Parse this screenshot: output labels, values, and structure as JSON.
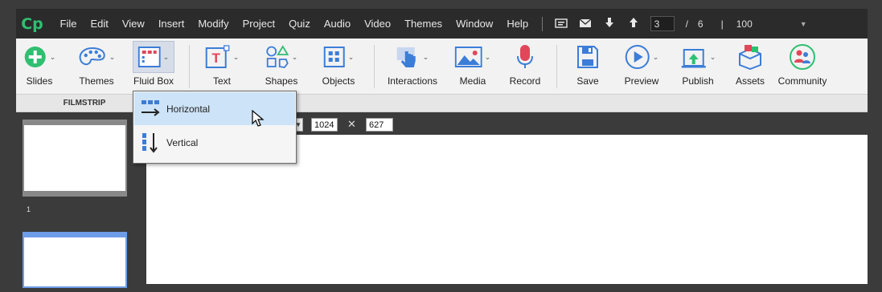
{
  "app": {
    "logo": "Cp"
  },
  "menubar": {
    "items": [
      "File",
      "Edit",
      "View",
      "Insert",
      "Modify",
      "Project",
      "Quiz",
      "Audio",
      "Video",
      "Themes",
      "Window",
      "Help"
    ],
    "icons": [
      "closed-caption-icon",
      "mail-icon",
      "arrow-down-icon",
      "arrow-up-icon"
    ],
    "slide_current": "3",
    "slide_sep": "/",
    "slide_total": "6",
    "divider": "|",
    "zoom": "100"
  },
  "toolbar": {
    "slides": "Slides",
    "themes": "Themes",
    "fluid_box": "Fluid Box",
    "text": "Text",
    "shapes": "Shapes",
    "objects": "Objects",
    "interactions": "Interactions",
    "media": "Media",
    "record": "Record",
    "save": "Save",
    "preview": "Preview",
    "publish": "Publish",
    "assets": "Assets",
    "community": "Community"
  },
  "panel": {
    "filmstrip": "FILMSTRIP",
    "thumb_1_number": "1"
  },
  "stage": {
    "width": "1024",
    "height": "627"
  },
  "dropdown": {
    "horizontal": "Horizontal",
    "vertical": "Vertical"
  },
  "colors": {
    "menubar": "#2b2b2b",
    "toolbar": "#f2f2f2",
    "accent_green": "#2fbf71",
    "accent_blue": "#3b7dd8",
    "record_red": "#e0475a",
    "selected": "#cde3f7"
  }
}
